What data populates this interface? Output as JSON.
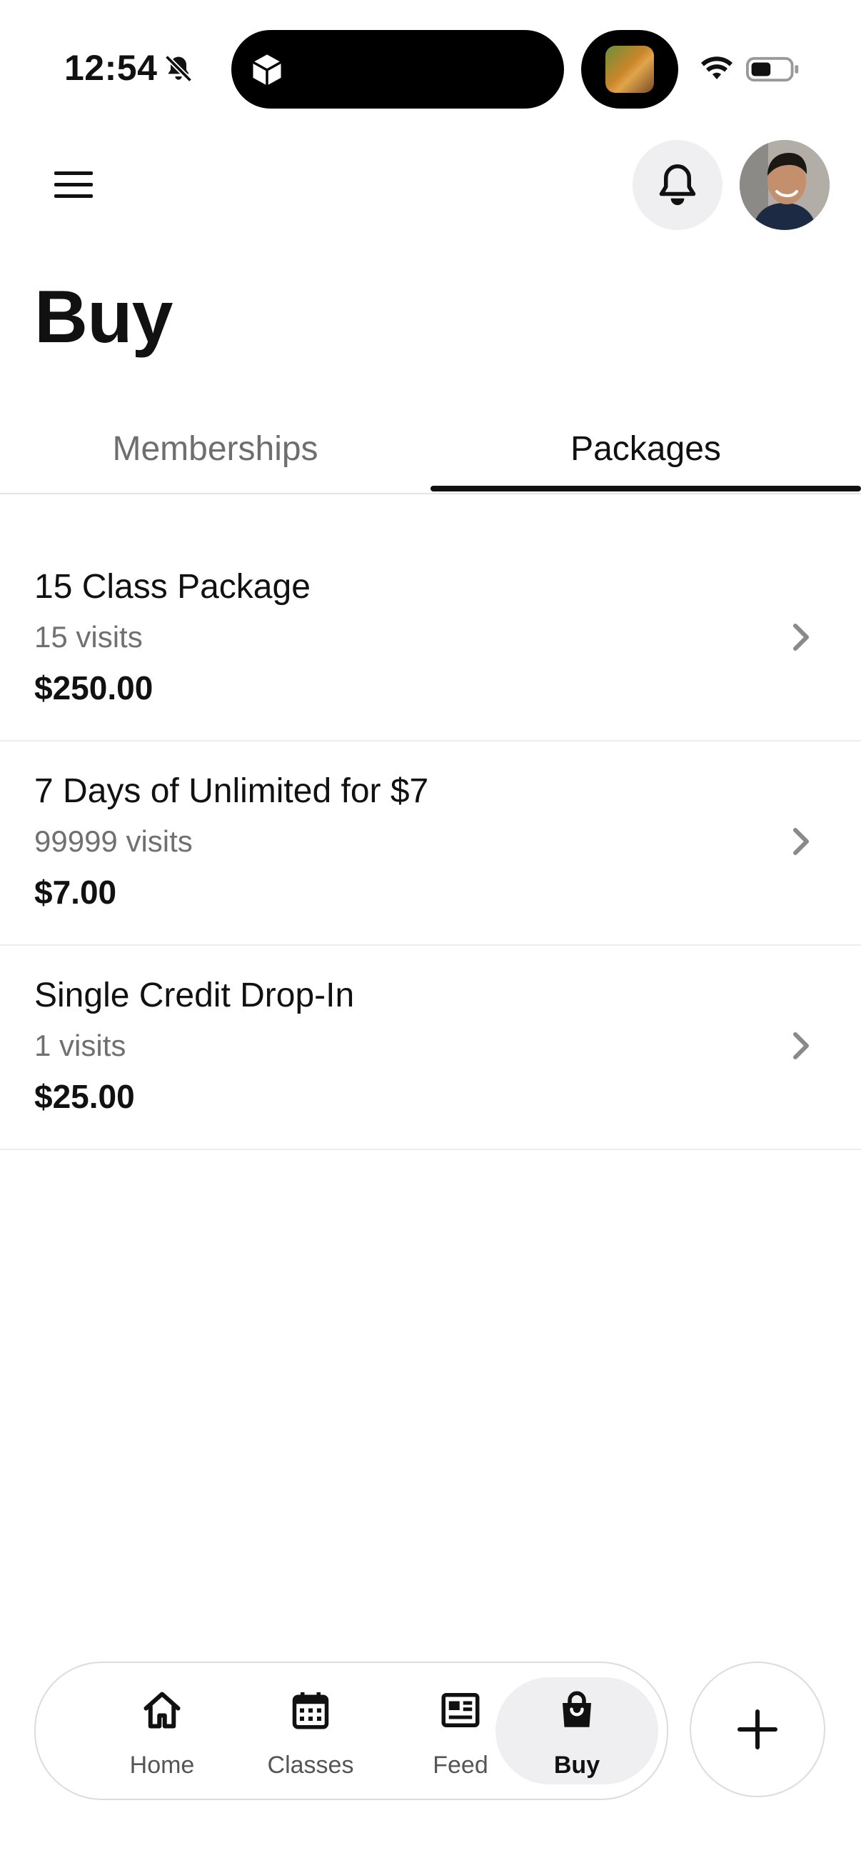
{
  "status_bar": {
    "time": "12:54"
  },
  "header": {
    "menu_icon": "hamburger-icon",
    "notification_icon": "bell-icon",
    "avatar_alt": "User avatar"
  },
  "page": {
    "title": "Buy"
  },
  "tabs": [
    {
      "label": "Memberships",
      "selected": false
    },
    {
      "label": "Packages",
      "selected": true
    }
  ],
  "packages": [
    {
      "title": "15 Class Package",
      "visits": "15 visits",
      "price": "$250.00"
    },
    {
      "title": "7 Days of Unlimited for $7",
      "visits": "99999 visits",
      "price": "$7.00"
    },
    {
      "title": "Single Credit Drop-In",
      "visits": "1 visits",
      "price": "$25.00"
    }
  ],
  "bottom_nav": {
    "items": [
      {
        "label": "Home",
        "icon": "home-icon"
      },
      {
        "label": "Classes",
        "icon": "calendar-icon"
      },
      {
        "label": "Feed",
        "icon": "newspaper-icon"
      },
      {
        "label": "Buy",
        "icon": "shopping-bag-icon",
        "active": true
      }
    ],
    "fab_icon": "plus-icon"
  }
}
